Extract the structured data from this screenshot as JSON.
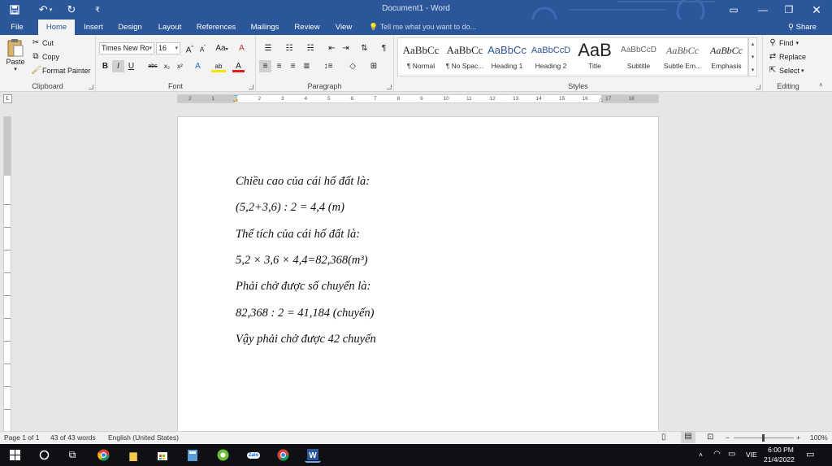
{
  "window": {
    "title": "Document1 - Word",
    "quick_access": [
      "save-icon",
      "undo-icon",
      "redo-icon",
      "customize-icon"
    ],
    "controls": [
      "ribbon-display-icon",
      "minimize-icon",
      "restore-icon",
      "close-icon"
    ]
  },
  "tabs": [
    "File",
    "Home",
    "Insert",
    "Design",
    "Layout",
    "References",
    "Mailings",
    "Review",
    "View"
  ],
  "active_tab": "Home",
  "tell_me": "Tell me what you want to do...",
  "share": "Share",
  "clipboard": {
    "paste": "Paste",
    "cut": "Cut",
    "copy": "Copy",
    "format_painter": "Format Painter",
    "label": "Clipboard"
  },
  "font": {
    "name": "Times New Ro",
    "size": "16",
    "label": "Font",
    "grow": "A",
    "shrink": "A",
    "case": "Aa",
    "bold": "B",
    "italic": "I",
    "underline": "U",
    "strike": "abc",
    "sub": "x₂",
    "sup": "x²",
    "effects": "A",
    "highlight": "ab",
    "color": "A"
  },
  "paragraph": {
    "label": "Paragraph",
    "show_marks": "¶"
  },
  "styles": {
    "label": "Styles",
    "items": [
      {
        "preview": "AaBbCc",
        "name": "¶ Normal"
      },
      {
        "preview": "AaBbCc",
        "name": "¶ No Spac..."
      },
      {
        "preview": "AaBbCc",
        "name": "Heading 1"
      },
      {
        "preview": "AaBbCcD",
        "name": "Heading 2"
      },
      {
        "preview": "AaB",
        "name": "Title"
      },
      {
        "preview": "AaBbCcD",
        "name": "Subtitle"
      },
      {
        "preview": "AaBbCc",
        "name": "Subtle Em..."
      },
      {
        "preview": "AaBbCc",
        "name": "Emphasis"
      }
    ]
  },
  "editing": {
    "find": "Find",
    "replace": "Replace",
    "select": "Select",
    "label": "Editing"
  },
  "ruler": {
    "tab_selector": "L",
    "numbers": [
      "2",
      "1",
      "1",
      "2",
      "3",
      "4",
      "5",
      "6",
      "7",
      "8",
      "9",
      "10",
      "11",
      "12",
      "13",
      "14",
      "15",
      "16",
      "17",
      "18"
    ]
  },
  "document": {
    "lines": [
      "Chiều cao của cái hố đất là:",
      "(5,2+3,6) : 2 = 4,4 (m)",
      "Thể tích của cái hố đất là:",
      "5,2 × 3,6 × 4,4=82,368(m³)",
      "Phải chở được số chuyến là:",
      "82,368 : 2 = 41,184 (chuyến)",
      "Vậy phải chở được 42 chuyến"
    ]
  },
  "status": {
    "page": "Page 1 of 1",
    "words": "43 of 43 words",
    "language": "English (United States)",
    "zoom": "100%",
    "zoom_minus": "−",
    "zoom_plus": "+"
  },
  "taskbar": {
    "apps": [
      "windows-start-icon",
      "search-circle-icon",
      "task-view-icon",
      "chrome-icon",
      "file-explorer-icon",
      "store-icon",
      "calculator-icon",
      "coccoc-icon",
      "zalo-icon",
      "chrome-profile-icon",
      "word-icon"
    ],
    "zalo_label": "Zalo",
    "input_lang": "VIE",
    "time": "6:00 PM",
    "date": "21/4/2022"
  }
}
